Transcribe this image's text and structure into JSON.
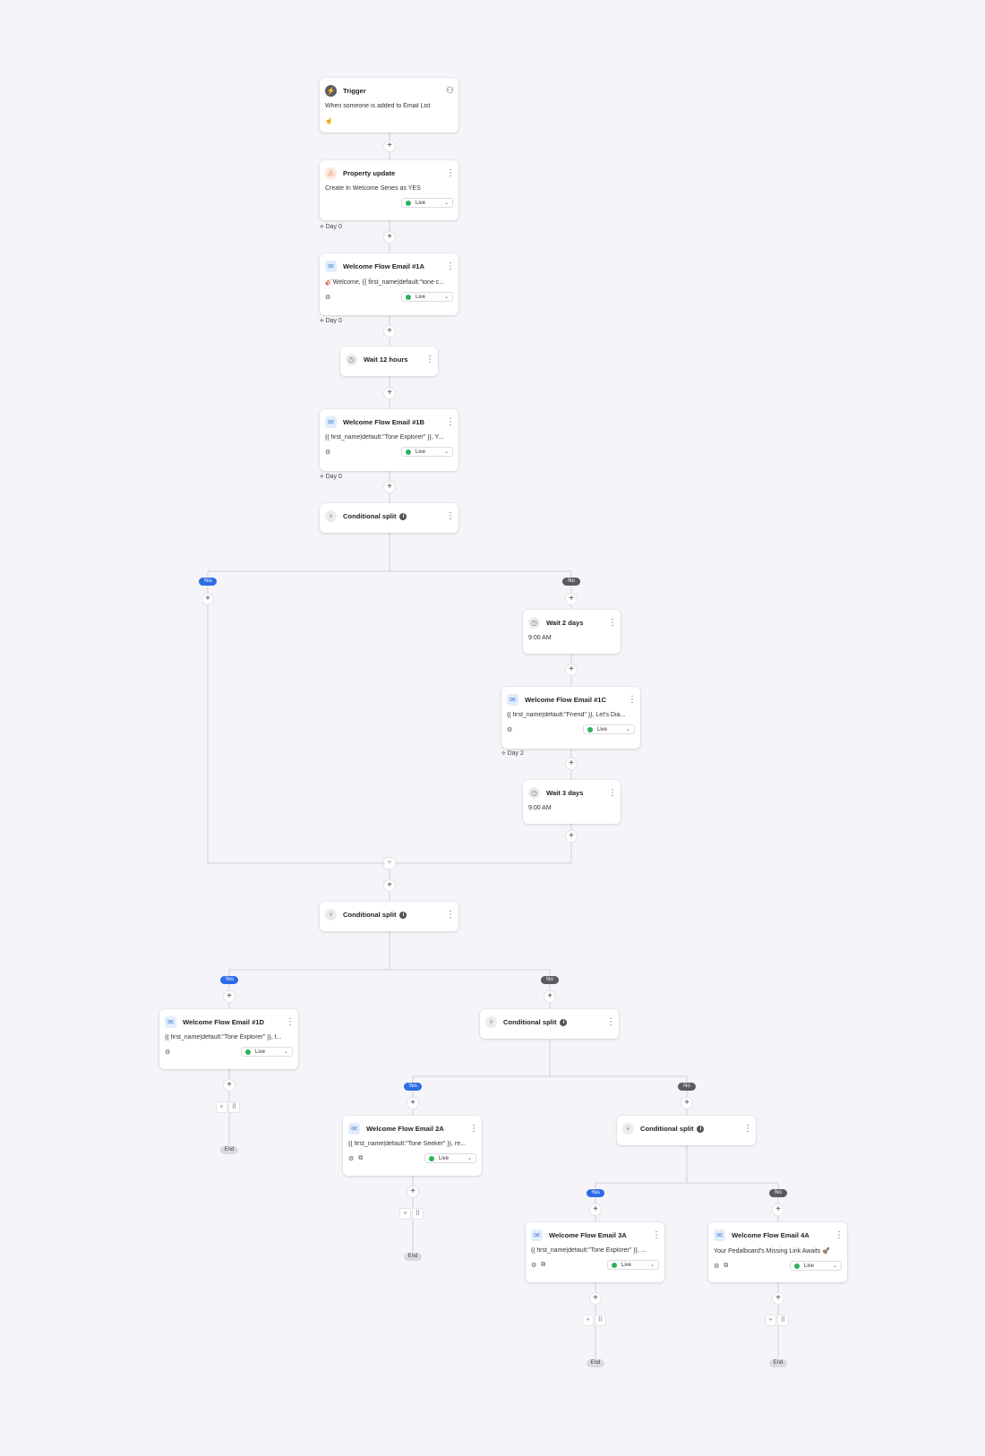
{
  "trigger": {
    "icon": "trigger-icon",
    "title": "Trigger",
    "desc": "When someone is added to Email List"
  },
  "property": {
    "icon": "property-icon",
    "title": "Property update",
    "desc": "Create In Welcome Series as YES",
    "status": "Live"
  },
  "e1a": {
    "title": "Welcome Flow Email #1A",
    "desc": "🎸Welcome, {{ first_name|default:\"tone c...",
    "status": "Live"
  },
  "e1b": {
    "title": "Welcome Flow Email #1B",
    "desc": "{{ first_name|default:\"Tone Explorer\" }}, Y...",
    "status": "Live"
  },
  "e1c": {
    "title": "Welcome Flow Email #1C",
    "desc": "{{ first_name|default:\"Friend\" }}, Let's Dia...",
    "status": "Live"
  },
  "e1d": {
    "title": "Welcome Flow Email #1D",
    "desc": "{{ first_name|default:\"Tone Explorer\" }}, t...",
    "status": "Live"
  },
  "e2a": {
    "title": "Welcome Flow Email 2A",
    "desc": "{{ first_name|default:\"Tone Seeker\" }}, re...",
    "status": "Live"
  },
  "e3a": {
    "title": "Welcome Flow Email 3A",
    "desc": "{{ first_name|default:\"Tone Explorer\" }}, ...",
    "status": "Live"
  },
  "e4a": {
    "title": "Welcome Flow Email 4A",
    "desc": "Your Pedalboard's Missing Link Awaits 🚀",
    "status": "Live"
  },
  "wait12": {
    "title": "Wait 12 hours"
  },
  "wait2": {
    "title": "Wait 2 days",
    "time": "9:00 AM"
  },
  "wait3": {
    "title": "Wait 3 days",
    "time": "9:00 AM"
  },
  "split_title": "Conditional split",
  "day0": "Day 0",
  "day2": "Day 2",
  "yes": "Yes",
  "no": "No",
  "end": "End",
  "colors": {
    "background": "#f5f5f9",
    "yes": "#2e6be6",
    "no": "#5a5a60",
    "live": "#2bb35a",
    "line": "#cfcfd6"
  }
}
